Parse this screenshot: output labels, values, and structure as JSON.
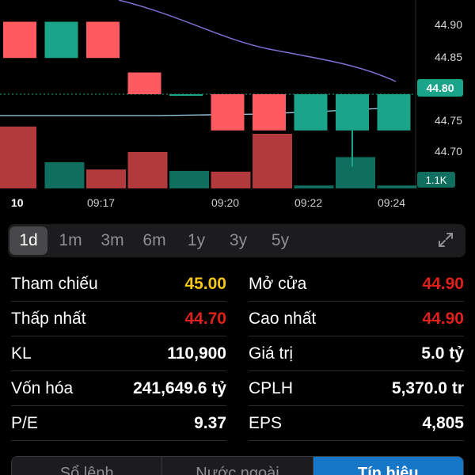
{
  "chart": {
    "price_ticks": [
      "44.90",
      "44.85",
      "44.80",
      "44.75",
      "44.70"
    ],
    "current_price": "44.80",
    "current_volume": "1.1K",
    "time_labels": [
      "10",
      "09:17",
      "09:20",
      "09:22",
      "09:24"
    ],
    "up_color": "#1aa58a",
    "down_color": "#ff5a5f"
  },
  "chart_data": {
    "type": "candlestick",
    "ylim": [
      44.67,
      44.93
    ],
    "candles": [
      {
        "open": 44.9,
        "close": 44.85,
        "dir": "down"
      },
      {
        "open": 44.85,
        "close": 44.9,
        "dir": "up"
      },
      {
        "open": 44.9,
        "close": 44.85,
        "dir": "down"
      },
      {
        "open": 44.83,
        "close": 44.8,
        "dir": "down"
      },
      {
        "open": 44.8,
        "close": 44.8,
        "dir": "flat"
      },
      {
        "open": 44.8,
        "close": 44.75,
        "dir": "down"
      },
      {
        "open": 44.8,
        "close": 44.75,
        "dir": "down"
      },
      {
        "open": 44.75,
        "close": 44.8,
        "dir": "up"
      },
      {
        "open": 44.75,
        "close": 44.8,
        "dir": "up",
        "low": 44.7
      },
      {
        "open": 44.75,
        "close": 44.8,
        "dir": "up"
      }
    ],
    "volume_dir": [
      "down",
      "up",
      "down",
      "down",
      "up",
      "down",
      "down",
      "up",
      "up",
      "up"
    ],
    "volume_levels": [
      0.85,
      0.36,
      0.26,
      0.5,
      0.24,
      0.23,
      0.75,
      0.04,
      0.43,
      0.04
    ]
  },
  "ranges": [
    {
      "label": "1d",
      "active": true
    },
    {
      "label": "1m",
      "active": false
    },
    {
      "label": "3m",
      "active": false
    },
    {
      "label": "6m",
      "active": false
    },
    {
      "label": "1y",
      "active": false
    },
    {
      "label": "3y",
      "active": false
    },
    {
      "label": "5y",
      "active": false
    }
  ],
  "stats": [
    {
      "l_label": "Tham chiếu",
      "l_value": "45.00",
      "l_color": "#f5c518",
      "r_label": "Mở cửa",
      "r_value": "44.90",
      "r_color": "#e0201b"
    },
    {
      "l_label": "Thấp nhất",
      "l_value": "44.70",
      "l_color": "#e0201b",
      "r_label": "Cao nhất",
      "r_value": "44.90",
      "r_color": "#e0201b"
    },
    {
      "l_label": "KL",
      "l_value": "110,900",
      "l_color": "#ffffff",
      "r_label": "Giá trị",
      "r_value": "5.0 tỷ",
      "r_color": "#ffffff"
    },
    {
      "l_label": "Vốn hóa",
      "l_value": "241,649.6 tỷ",
      "l_color": "#ffffff",
      "r_label": "CPLH",
      "r_value": "5,370.0 tr",
      "r_color": "#ffffff"
    },
    {
      "l_label": "P/E",
      "l_value": "9.37",
      "l_color": "#ffffff",
      "r_label": "EPS",
      "r_value": "4,805",
      "r_color": "#ffffff"
    }
  ],
  "bottom_tabs": [
    {
      "label": "Sổ lệnh",
      "active": false
    },
    {
      "label": "Nước ngoài",
      "active": false
    },
    {
      "label": "Tín hiệu",
      "active": true
    }
  ]
}
